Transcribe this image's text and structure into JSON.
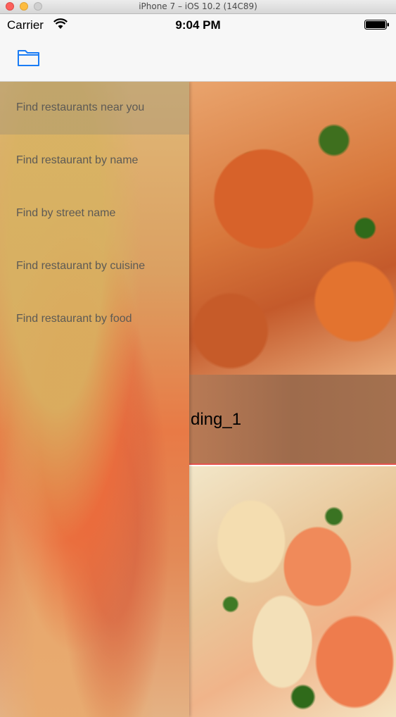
{
  "window": {
    "title": "iPhone 7 – iOS 10.2 (14C89)"
  },
  "status_bar": {
    "carrier": "Carrier",
    "time": "9:04 PM"
  },
  "navbar": {
    "icon": "folder-icon"
  },
  "side_menu": {
    "items": [
      {
        "label": "Find restaurants near you",
        "selected": true
      },
      {
        "label": "Find restaurant by name",
        "selected": false
      },
      {
        "label": "Find by street name",
        "selected": false
      },
      {
        "label": "Find restaurant by cuisine",
        "selected": false
      },
      {
        "label": "Find restaurant by food",
        "selected": false
      }
    ]
  },
  "content": {
    "cells": [
      {
        "label": "ding_1"
      }
    ]
  },
  "colors": {
    "accent": "#1a7cf5",
    "separator": "#e6534f"
  }
}
